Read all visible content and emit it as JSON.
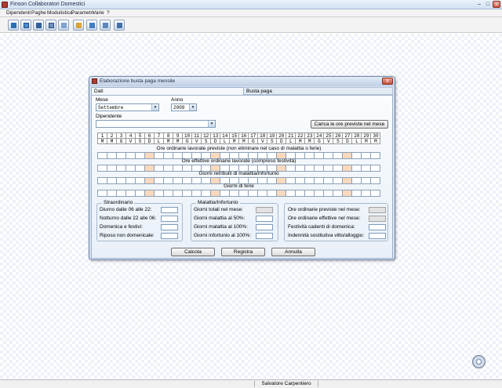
{
  "app": {
    "title": "Finson Collaboratori Domestici",
    "menu": [
      "Dipendenti",
      "Paghe",
      "Modulistica",
      "Parametri",
      "Varie",
      "?"
    ],
    "toolbar_icons": [
      "employees-icon",
      "copy-window-icon",
      "calculator-icon",
      "calendar-icon",
      "table-icon",
      "user-tools-icon",
      "edit-check-icon",
      "list-icon",
      "print-icon"
    ],
    "status_center": "Salvatore Carpentiero"
  },
  "dialog": {
    "title": "Elaborazione busta paga mensile",
    "close_label": "x",
    "tabs": [
      "Dati",
      "Busta paga"
    ],
    "mese_label": "Mese",
    "mese_value": "Settembre",
    "anno_label": "Anno",
    "anno_value": "2009",
    "dipendente_label": "Dipendente",
    "dipendente_value": "",
    "carica_label": "Carica le ore previste nel mese",
    "days": [
      "1",
      "2",
      "3",
      "4",
      "5",
      "6",
      "7",
      "8",
      "9",
      "10",
      "11",
      "12",
      "13",
      "14",
      "15",
      "16",
      "17",
      "18",
      "19",
      "20",
      "21",
      "22",
      "23",
      "24",
      "25",
      "26",
      "27",
      "28",
      "29",
      "30"
    ],
    "weekdays": [
      "M",
      "M",
      "G",
      "V",
      "S",
      "D",
      "L",
      "M",
      "M",
      "G",
      "V",
      "S",
      "D",
      "L",
      "M",
      "M",
      "G",
      "V",
      "S",
      "D",
      "L",
      "M",
      "M",
      "G",
      "V",
      "S",
      "D",
      "L",
      "M",
      "M"
    ],
    "holiday_index": [
      5,
      12,
      19,
      26
    ],
    "sections": [
      "Ore ordinarie lavorate previste (non eliminare nel caso di malattia o ferie)",
      "Ore effettive ordinarie lavorate (compreso festività)",
      "Giorni retribuiti di malattia/infortunio",
      "Giorni di ferie"
    ],
    "straordinario": {
      "title": "Straordinario",
      "items": [
        "Diurno dalle 06 alle 22:",
        "Notturno dalle 22 alle 06:",
        "Domenica e festivi:",
        "Riposo non domenicale:"
      ]
    },
    "malattia": {
      "title": "Malattia/Infortunio",
      "items": [
        "Giorni totali nel mese:",
        "Giorni malattia al 50%:",
        "Giorni malattia al 100%:",
        "Giorni infortunio al 100%:"
      ]
    },
    "riepilogo": {
      "items": [
        "Ore ordinarie previste nel mese:",
        "Ore ordinarie effettive nel mese:",
        "Festività cadenti di domenica:",
        "Indennità sostitutiva vitto/alloggio:"
      ]
    },
    "buttons": {
      "calcola": "Calcola",
      "registra": "Registra",
      "annulla": "Annulla"
    }
  }
}
